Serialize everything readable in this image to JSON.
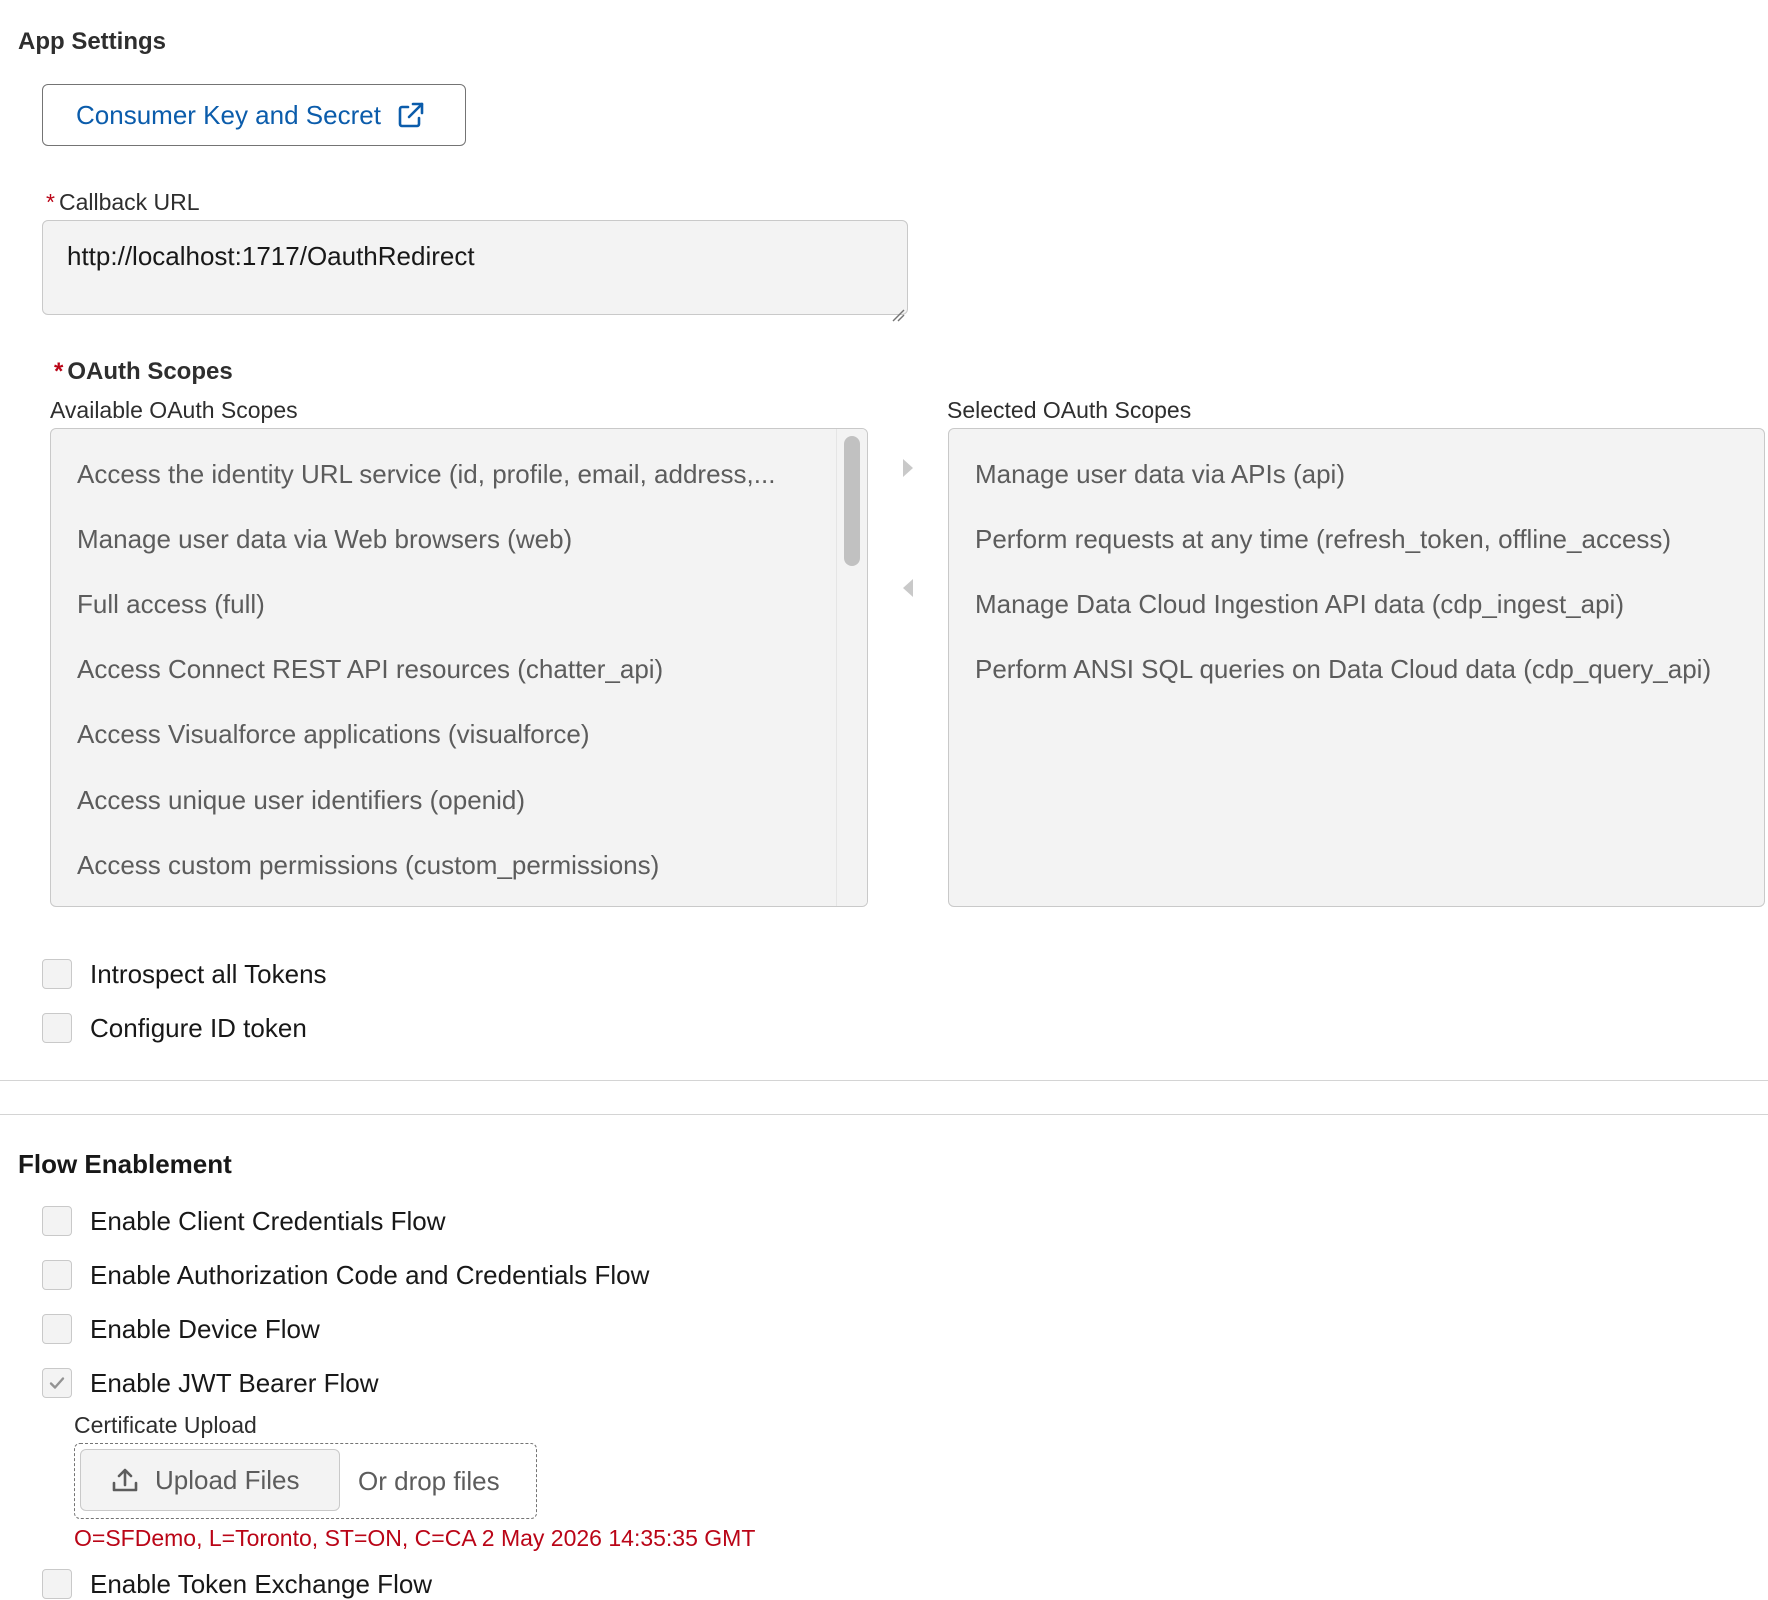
{
  "app_settings": {
    "title": "App Settings",
    "consumer_button": {
      "label": "Consumer Key and Secret",
      "icon": "external-link-icon"
    },
    "callback": {
      "required_marker": "*",
      "label": "Callback URL",
      "value": "http://localhost:1717/OauthRedirect"
    },
    "oauth": {
      "required_marker": "*",
      "label": "OAuth Scopes",
      "available_label": "Available OAuth Scopes",
      "selected_label": "Selected OAuth Scopes",
      "available": [
        "Access the identity URL service (id, profile, email, address,...",
        "Manage user data via Web browsers (web)",
        "Full access (full)",
        "Access Connect REST API resources (chatter_api)",
        "Access Visualforce applications (visualforce)",
        "Access unique user identifiers (openid)",
        "Access custom permissions (custom_permissions)"
      ],
      "selected": [
        "Manage user data via APIs (api)",
        "Perform requests at any time (refresh_token, offline_access)",
        "Manage Data Cloud Ingestion API data (cdp_ingest_api)",
        "Perform ANSI SQL queries on Data Cloud data (cdp_query_api)"
      ]
    },
    "checkboxes": [
      {
        "label": "Introspect all Tokens",
        "checked": false
      },
      {
        "label": "Configure ID token",
        "checked": false
      }
    ]
  },
  "flow_enablement": {
    "title": "Flow Enablement",
    "checkboxes": [
      {
        "label": "Enable Client Credentials Flow",
        "checked": false
      },
      {
        "label": "Enable Authorization Code and Credentials Flow",
        "checked": false
      },
      {
        "label": "Enable Device Flow",
        "checked": false
      },
      {
        "label": "Enable JWT Bearer Flow",
        "checked": true
      },
      {
        "label": "Enable Token Exchange Flow",
        "checked": false
      }
    ],
    "certificate": {
      "label": "Certificate Upload",
      "upload_button": "Upload Files",
      "drop_text": "Or drop files",
      "info": "O=SFDemo, L=Toronto, ST=ON, C=CA 2 May 2026 14:35:35 GMT"
    }
  },
  "colors": {
    "link": "#0b5cab",
    "error": "#ba0517",
    "field_bg": "#f3f3f3",
    "border": "#c9c9c9"
  }
}
